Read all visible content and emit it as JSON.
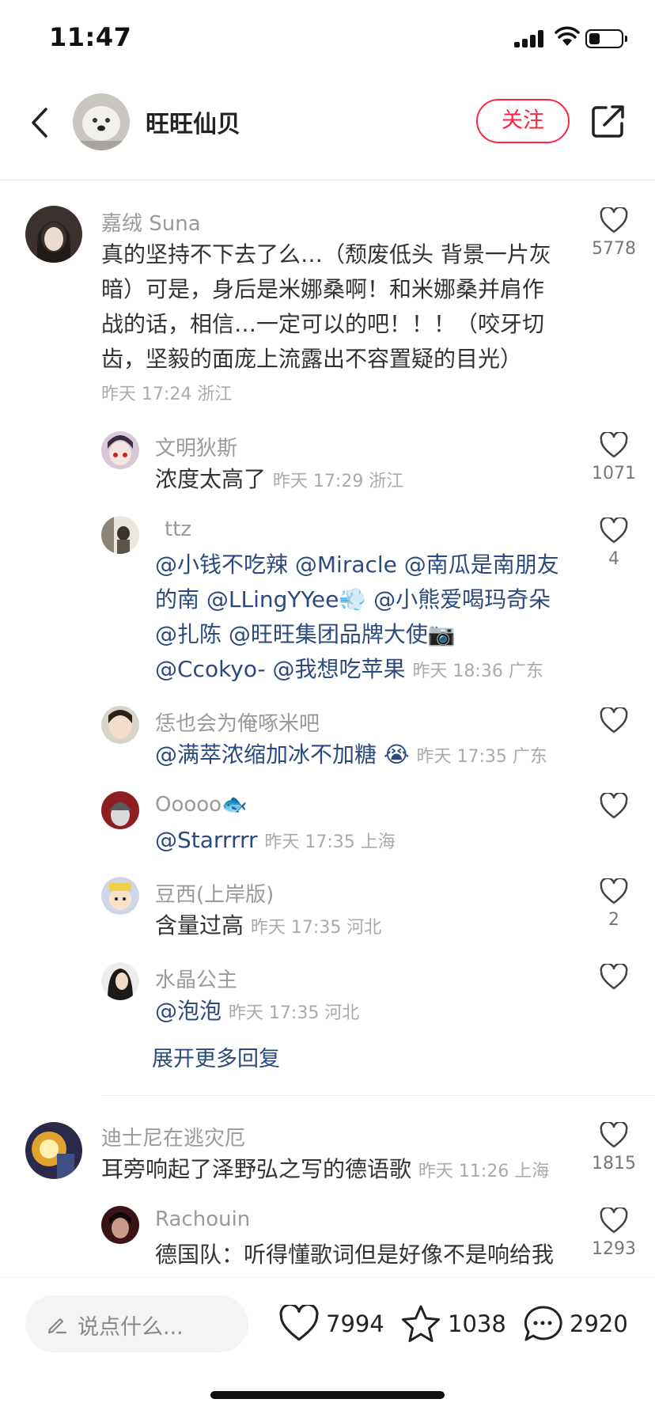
{
  "status": {
    "time": "11:47",
    "battery_level": 0.35
  },
  "header": {
    "author": "旺旺仙贝",
    "follow_label": "关注"
  },
  "comments": [
    {
      "user": "嘉绒 Suna",
      "text": "真的坚持不下去了么…（颓废低头 背景一片灰暗）可是，身后是米娜桑啊！和米娜桑并肩作战的话，相信…一定可以的吧！！！（咬牙切齿，坚毅的面庞上流露出不容置疑的目光）",
      "meta": "昨天 17:24 浙江",
      "likes": "5778",
      "replies": [
        {
          "user": "文明狄斯",
          "text": "浓度太高了",
          "meta": "昨天 17:29 浙江",
          "likes": "1071"
        },
        {
          "user": "ttz",
          "mention_lines": [
            "@小钱不吃辣 @Miracle @南瓜是南朋友",
            "的南 @LLingYYee💨 @小熊爱喝玛奇朵",
            "@扎陈 @旺旺集团品牌大使📷",
            "@Ccokyo- @我想吃苹果"
          ],
          "meta": "昨天 18:36 广东",
          "likes": "4"
        },
        {
          "user": "恁也会为俺啄米吧",
          "text": "@满萃浓缩加冰不加糖 😭",
          "meta": "昨天 17:35 广东",
          "likes": ""
        },
        {
          "user": "Ooooo🐟",
          "text": "@Starrrrr",
          "meta": "昨天 17:35 上海",
          "likes": ""
        },
        {
          "user": "豆西(上岸版)",
          "text": "含量过高",
          "meta": "昨天 17:35 河北",
          "likes": "2"
        },
        {
          "user": "水晶公主",
          "text": "@泡泡",
          "meta": "昨天 17:35 河北",
          "likes": ""
        }
      ],
      "expand_label": "展开更多回复"
    },
    {
      "user": "迪士尼在逃灾厄",
      "text": "耳旁响起了泽野弘之写的德语歌",
      "meta": "昨天 11:26 上海",
      "likes": "1815",
      "replies": [
        {
          "user": "Rachouin",
          "text": "德国队：听得懂歌词但是好像不是响给我",
          "likes": "1293"
        }
      ]
    }
  ],
  "bottom": {
    "input_placeholder": "说点什么...",
    "likes": "7994",
    "stars": "1038",
    "comments": "2920"
  },
  "colors": {
    "accent": "#ff2442",
    "mention": "#2b4a7e"
  }
}
